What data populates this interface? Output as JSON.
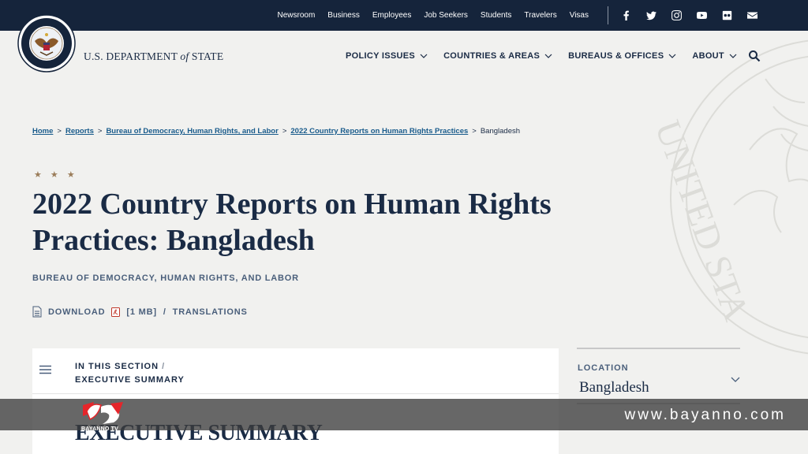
{
  "topbar": {
    "links": [
      "Newsroom",
      "Business",
      "Employees",
      "Job Seekers",
      "Students",
      "Travelers",
      "Visas"
    ],
    "social_icons": [
      "facebook-icon",
      "twitter-icon",
      "instagram-icon",
      "youtube-icon",
      "flickr-icon",
      "email-icon"
    ]
  },
  "header": {
    "brand_prefix": "U.S. DEPARTMENT",
    "brand_of": "of",
    "brand_suffix": "STATE",
    "nav": [
      "POLICY ISSUES",
      "COUNTRIES & AREAS",
      "BUREAUS & OFFICES",
      "ABOUT"
    ]
  },
  "breadcrumb": {
    "items": [
      "Home",
      "Reports",
      "Bureau of Democracy, Human Rights, and Labor",
      "2022 Country Reports on Human Rights Practices"
    ],
    "current": "Bangladesh",
    "separator": ">"
  },
  "page": {
    "stars": "★ ★ ★",
    "title_line1": "2022 Country Reports on Human Rights",
    "title_line2": "Practices: Bangladesh",
    "bureau": "BUREAU OF DEMOCRACY, HUMAN RIGHTS, AND LABOR",
    "download_label": "DOWNLOAD",
    "download_size": "[1 MB]",
    "slash": "/",
    "translations_label": "TRANSLATIONS"
  },
  "section": {
    "in_this_section": "IN THIS SECTION",
    "slash": "/",
    "current": "EXECUTIVE SUMMARY",
    "heading": "EXECUTIVE SUMMARY"
  },
  "location": {
    "label": "LOCATION",
    "value": "Bangladesh"
  },
  "overlay": {
    "site": "www.bayanno.com",
    "logo_text": "BAYANNO TV"
  },
  "colors": {
    "topbar": "#15243b",
    "navy": "#1a2b45",
    "link": "#1a5c8c",
    "muted": "#4a5f7b",
    "accent_gold": "#9b7d5a"
  }
}
